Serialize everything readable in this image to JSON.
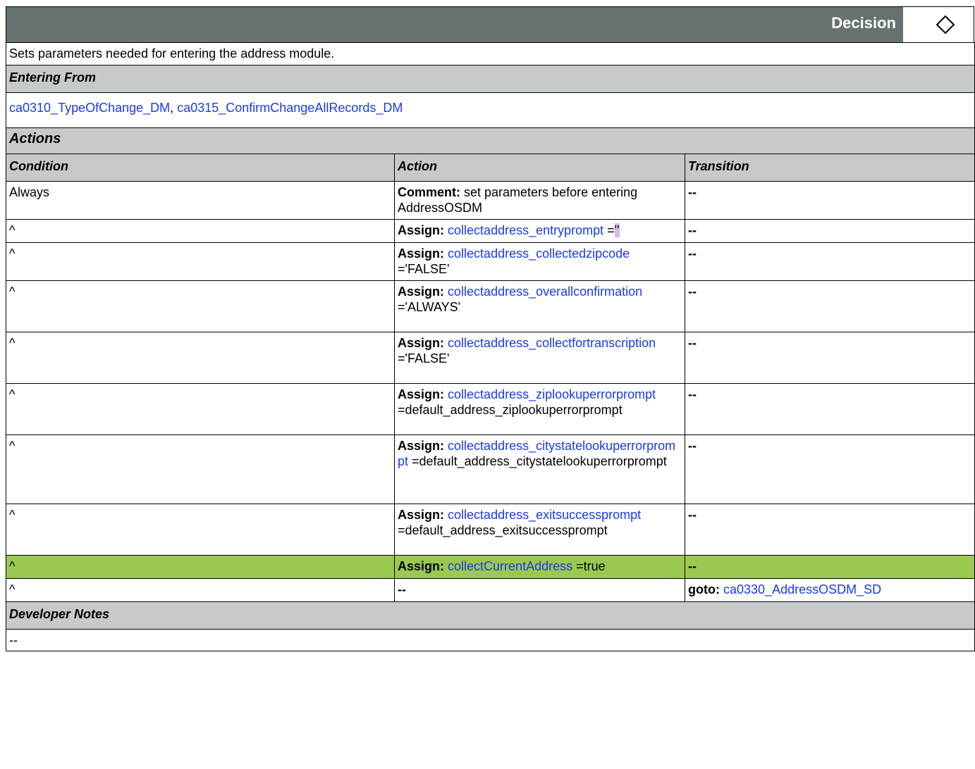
{
  "header": {
    "type_label": "Decision",
    "icon": "diamond-icon"
  },
  "description": "Sets parameters needed for entering the address module.",
  "entering_from": {
    "title": "Entering From",
    "link1": "ca0310_TypeOfChange_DM",
    "sep": ",",
    "link2": "ca0315_ConfirmChangeAllRecords_DM"
  },
  "actions": {
    "title": "Actions",
    "columns": {
      "condition": "Condition",
      "action": "Action",
      "transition": "Transition"
    },
    "rows": [
      {
        "condition": "Always",
        "label": "Comment:",
        "text": " set parameters before entering AddressOSDM",
        "transition": "--"
      },
      {
        "condition": "^",
        "label": "Assign:",
        "link": "collectaddress_entryprompt",
        "value": " =",
        "value_hl": "''",
        "transition": "--"
      },
      {
        "condition": "^",
        "label": "Assign:",
        "link": "collectaddress_collectedzipcode",
        "value": " ='FALSE'",
        "transition": "--"
      },
      {
        "condition": "^",
        "label": "Assign:",
        "link": "collectaddress_overallconfirmation",
        "value": " ='ALWAYS'",
        "transition": "--"
      },
      {
        "condition": "^",
        "label": "Assign:",
        "link": "collectaddress_collectfortranscription",
        "value": " ='FALSE'",
        "transition": "--"
      },
      {
        "condition": "^",
        "label": "Assign:",
        "link": "collectaddress_ziplookuperrorprompt",
        "value": " =default_address_ziplookuperrorprompt",
        "transition": "--"
      },
      {
        "condition": "^",
        "label": "Assign:",
        "link": "collectaddress_citystatelookuperrorprompt",
        "value": " =default_address_citystatelookuperrorprompt",
        "transition": "--"
      },
      {
        "condition": "^",
        "label": "Assign:",
        "link": "collectaddress_exitsuccessprompt",
        "value": " =default_address_exitsuccessprompt",
        "transition": "--"
      },
      {
        "condition": "^",
        "label": "Assign:",
        "link": "collectCurrentAddress",
        "value": " =true",
        "transition": "--"
      },
      {
        "condition": "^",
        "action": "--",
        "transition_label": "goto:",
        "transition_link": "ca0330_AddressOSDM_SD"
      }
    ]
  },
  "developer_notes": {
    "title": "Developer Notes",
    "text": "--"
  },
  "colors": {
    "header_bar": "#667271",
    "section_bg": "#c7cacb",
    "highlight_row": "#9bc850",
    "link": "#1a39f0"
  }
}
